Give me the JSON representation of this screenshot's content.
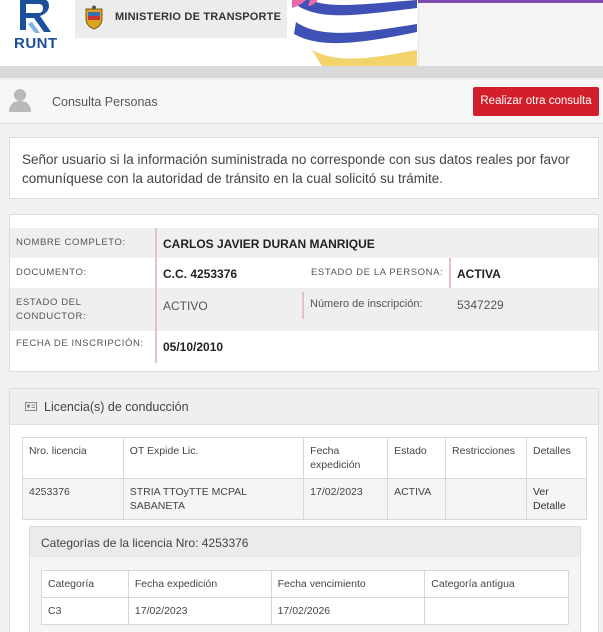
{
  "header": {
    "logo_text": "RUNT",
    "ministry": "MINISTERIO DE TRANSPORTE"
  },
  "toolbar": {
    "title": "Consulta Personas",
    "action_button": "Realizar otra consulta"
  },
  "notice": {
    "text": "Señor usuario si la información suministrada no corresponde con sus datos reales por favor comuníquese con la autoridad de tránsito en la cual solicitó su trámite."
  },
  "person": {
    "full_name_label": "NOMBRE COMPLETO:",
    "full_name": "CARLOS JAVIER DURAN MANRIQUE",
    "document_label": "DOCUMENTO:",
    "document": "C.C. 4253376",
    "person_status_label": "ESTADO DE LA PERSONA:",
    "person_status": "ACTIVA",
    "driver_status_label": "ESTADO DEL CONDUCTOR:",
    "driver_status": "ACTIVO",
    "registration_number_label": "Número de inscripción:",
    "registration_number": "5347229",
    "registration_date_label": "FECHA DE INSCRIPCIÓN:",
    "registration_date": "05/10/2010"
  },
  "licenses": {
    "title": "Licencia(s) de conducción",
    "columns": [
      "Nro. licencia",
      "OT Expide Lic.",
      "Fecha expedición",
      "Estado",
      "Restricciones",
      "Detalles"
    ],
    "rows": [
      {
        "number": "4253376",
        "issuer": "STRIA TTOyTTE MCPAL SABANETA",
        "issue_date": "17/02/2023",
        "status": "ACTIVA",
        "restrictions": "",
        "details_link": "Ver Detalle"
      }
    ]
  },
  "categories": {
    "title": "Categorías de la licencia Nro: 4253376",
    "columns": [
      "Categoría",
      "Fecha expedición",
      "Fecha vencimiento",
      "Categoría antigua"
    ],
    "rows": [
      {
        "category": "C3",
        "issue_date": "17/02/2023",
        "expiry_date": "17/02/2026",
        "old_category": ""
      }
    ]
  },
  "colors": {
    "primary_button": "#d21f2b",
    "brand_blue": "#1b4f9c",
    "accent_purple": "#7b4bb3"
  }
}
